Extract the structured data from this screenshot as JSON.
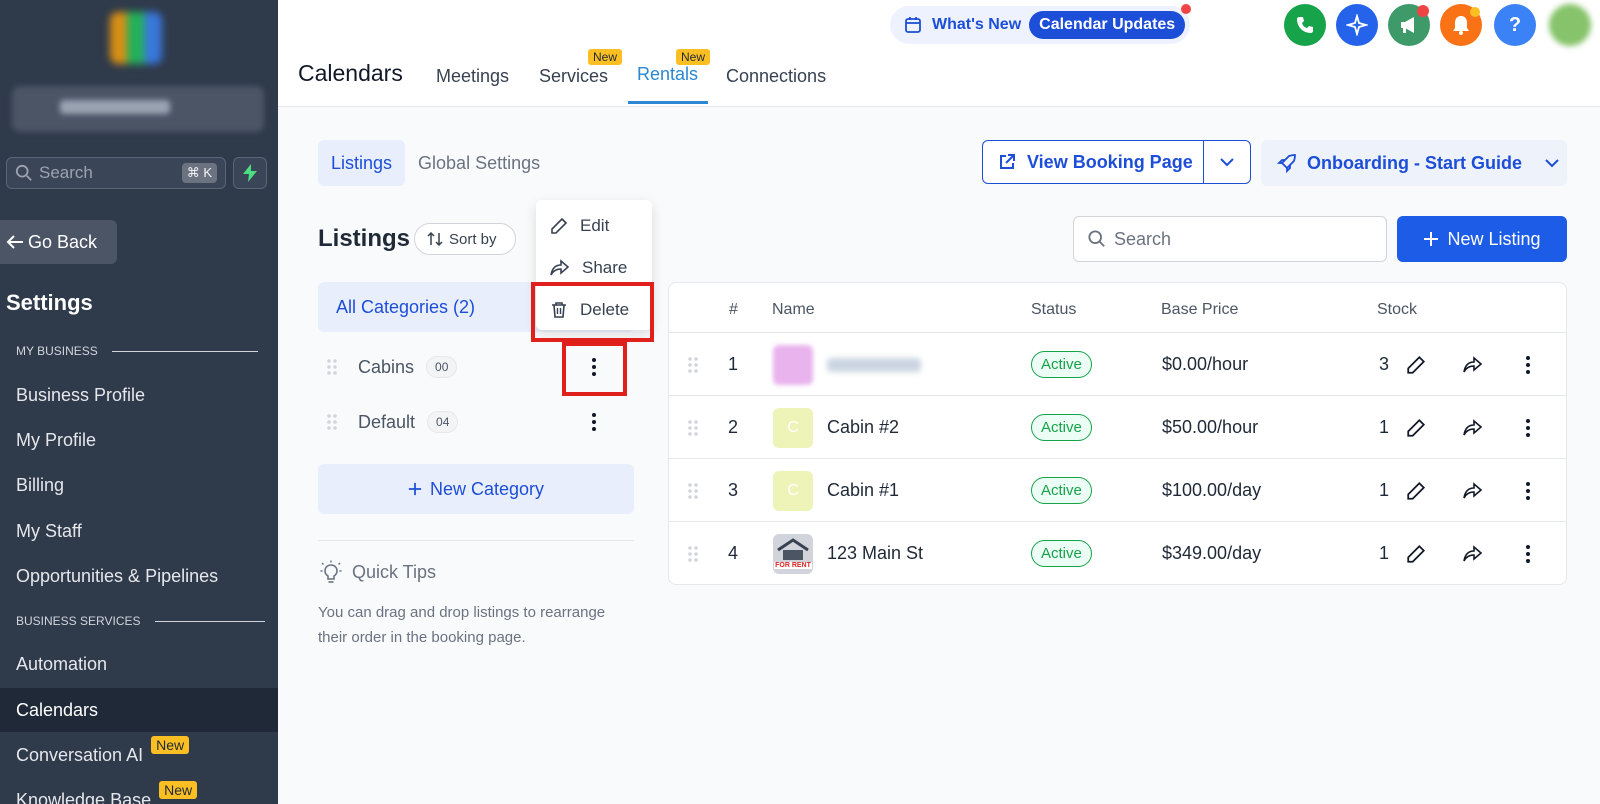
{
  "sidebar": {
    "search_placeholder": "Search",
    "search_shortcut": "⌘ K",
    "go_back": "Go Back",
    "settings_title": "Settings",
    "section_my_business": "MY BUSINESS",
    "section_business_services": "BUSINESS SERVICES",
    "items": [
      {
        "label": "Business Profile"
      },
      {
        "label": "My Profile"
      },
      {
        "label": "Billing"
      },
      {
        "label": "My Staff"
      },
      {
        "label": "Opportunities & Pipelines"
      },
      {
        "label": "Automation"
      },
      {
        "label": "Calendars"
      },
      {
        "label": "Conversation AI",
        "badge": "New"
      },
      {
        "label": "Knowledge Base",
        "badge": "New"
      }
    ]
  },
  "header": {
    "whats_new": "What's New",
    "calendar_updates": "Calendar Updates",
    "page_title": "Calendars",
    "tabs": [
      {
        "label": "Meetings"
      },
      {
        "label": "Services",
        "badge": "New"
      },
      {
        "label": "Rentals",
        "badge": "New"
      },
      {
        "label": "Connections"
      }
    ],
    "help_label": "?"
  },
  "content": {
    "subtabs": [
      "Listings",
      "Global Settings"
    ],
    "view_booking_page": "View Booking Page",
    "onboarding": "Onboarding - Start Guide",
    "listings_title": "Listings",
    "sort_by": "Sort by",
    "search_placeholder": "Search",
    "new_listing": "New Listing",
    "all_categories": "All Categories (2)",
    "categories": [
      {
        "name": "Cabins",
        "count": "00"
      },
      {
        "name": "Default",
        "count": "04"
      }
    ],
    "new_category": "New Category",
    "quick_tips_title": "Quick Tips",
    "quick_tips_text": "You can drag and drop listings to rearrange their order in the booking page."
  },
  "context_menu": {
    "items": [
      "Edit",
      "Share",
      "Delete"
    ]
  },
  "table": {
    "headers": [
      "#",
      "Name",
      "Status",
      "Base Price",
      "Stock"
    ],
    "rows": [
      {
        "num": "1",
        "name": "",
        "thumb": "",
        "status": "Active",
        "price": "$0.00/hour",
        "stock": "3"
      },
      {
        "num": "2",
        "name": "Cabin #2",
        "thumb": "C",
        "status": "Active",
        "price": "$50.00/hour",
        "stock": "1"
      },
      {
        "num": "3",
        "name": "Cabin #1",
        "thumb": "C",
        "status": "Active",
        "price": "$100.00/day",
        "stock": "1"
      },
      {
        "num": "4",
        "name": "123 Main St",
        "thumb": "FOR RENT",
        "status": "Active",
        "price": "$349.00/day",
        "stock": "1"
      }
    ]
  },
  "colors": {
    "sidebar_bg": "#2f3a4b",
    "primary": "#1d4ed8",
    "active_status": "#16a34a",
    "highlight": "#e0201b"
  }
}
